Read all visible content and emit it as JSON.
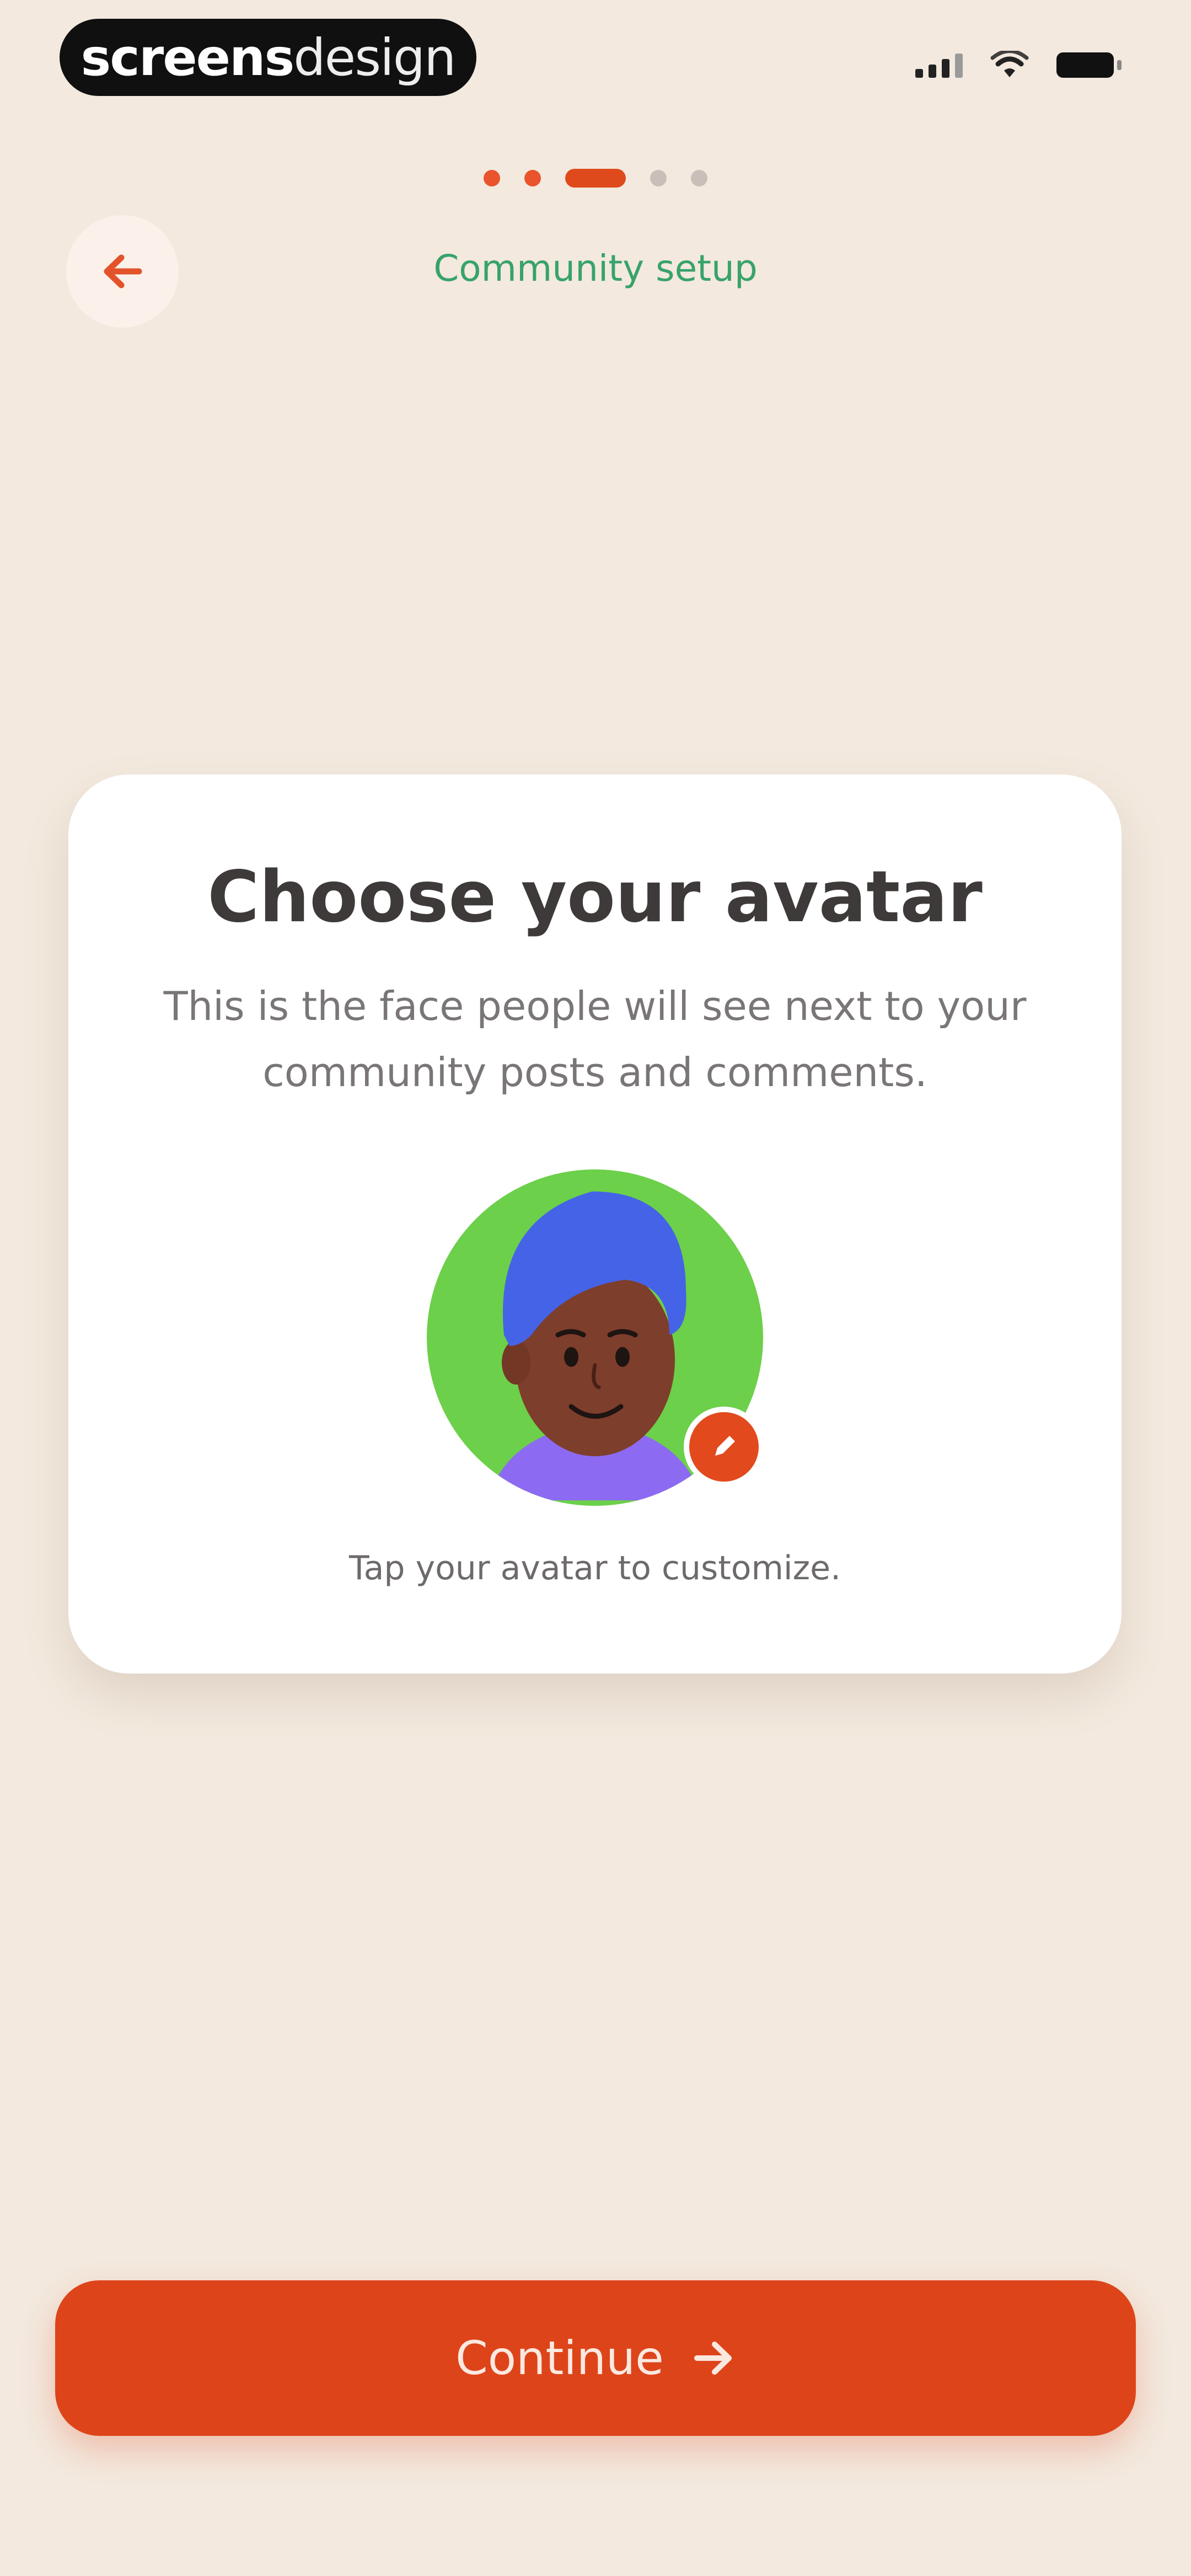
{
  "status_bar": {
    "brand_bold": "screens",
    "brand_light": "design",
    "icons": [
      "signal-icon",
      "wifi-icon",
      "battery-icon"
    ]
  },
  "progress": {
    "total_steps": 5,
    "current_step": 3
  },
  "header": {
    "back_icon": "arrow-left-icon",
    "title": "Community setup"
  },
  "card": {
    "title": "Choose your avatar",
    "description": "This is the face people will see next to your community posts and comments.",
    "hint": "Tap your avatar to customize.",
    "edit_icon": "pencil-icon"
  },
  "footer": {
    "continue_label": "Continue",
    "continue_icon": "arrow-right-icon"
  },
  "colors": {
    "background": "#F3E9DE",
    "accent": "#DE441A",
    "title_green": "#38A36A",
    "avatar_bg": "#6CD04A",
    "avatar_hair": "#4563E6",
    "avatar_skin": "#7E3E2C",
    "avatar_shirt": "#8C6BF2"
  }
}
